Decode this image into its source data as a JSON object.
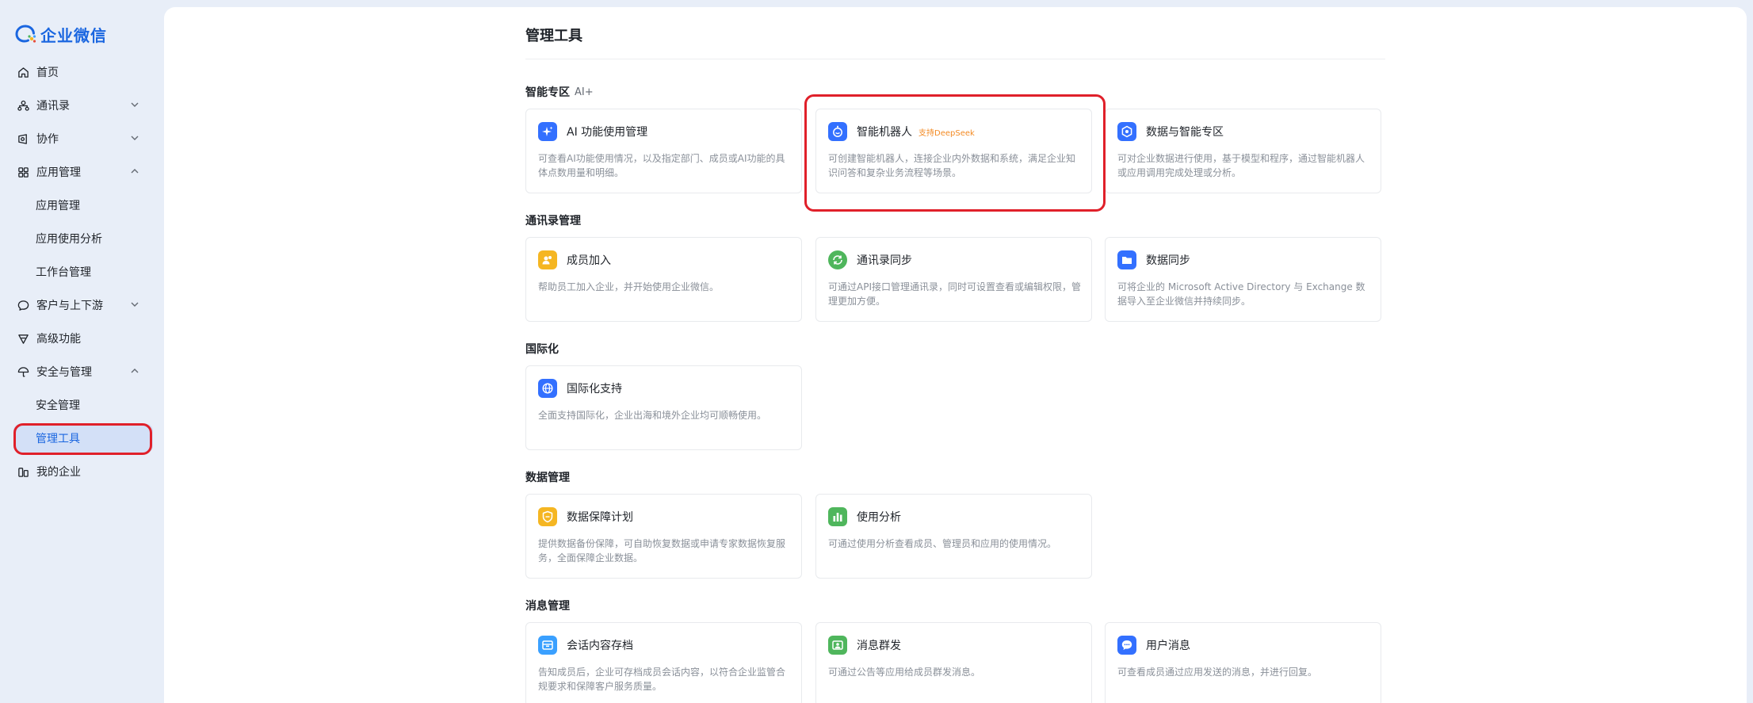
{
  "app": {
    "name": "企业微信"
  },
  "sidebar": {
    "items": [
      {
        "label": "首页"
      },
      {
        "label": "通讯录"
      },
      {
        "label": "协作"
      },
      {
        "label": "应用管理"
      },
      {
        "label": "应用管理"
      },
      {
        "label": "应用使用分析"
      },
      {
        "label": "工作台管理"
      },
      {
        "label": "客户与上下游"
      },
      {
        "label": "高级功能"
      },
      {
        "label": "安全与管理"
      },
      {
        "label": "安全管理"
      },
      {
        "label": "管理工具"
      },
      {
        "label": "我的企业"
      }
    ]
  },
  "main": {
    "title": "管理工具",
    "sections": [
      {
        "title": "智能专区",
        "tag": "AI+",
        "cards": [
          {
            "title": "AI 功能使用管理",
            "desc": "可查看AI功能使用情况，以及指定部门、成员或AI功能的具体点数用量和明细。"
          },
          {
            "title": "智能机器人",
            "badge": "支持DeepSeek",
            "desc": "可创建智能机器人，连接企业内外数据和系统，满足企业知识问答和复杂业务流程等场景。"
          },
          {
            "title": "数据与智能专区",
            "desc": "可对企业数据进行使用，基于模型和程序，通过智能机器人或应用调用完成处理或分析。"
          }
        ]
      },
      {
        "title": "通讯录管理",
        "cards": [
          {
            "title": "成员加入",
            "desc": "帮助员工加入企业，并开始使用企业微信。"
          },
          {
            "title": "通讯录同步",
            "desc": "可通过API接口管理通讯录，同时可设置查看或编辑权限，管理更加方便。"
          },
          {
            "title": "数据同步",
            "desc": "可将企业的 Microsoft Active Directory 与 Exchange 数据导入至企业微信并持续同步。"
          }
        ]
      },
      {
        "title": "国际化",
        "cards": [
          {
            "title": "国际化支持",
            "desc": "全面支持国际化，企业出海和境外企业均可顺畅使用。"
          }
        ]
      },
      {
        "title": "数据管理",
        "cards": [
          {
            "title": "数据保障计划",
            "desc": "提供数据备份保障，可自助恢复数据或申请专家数据恢复服务，全面保障企业数据。"
          },
          {
            "title": "使用分析",
            "desc": "可通过使用分析查看成员、管理员和应用的使用情况。"
          }
        ]
      },
      {
        "title": "消息管理",
        "cards": [
          {
            "title": "会话内容存档",
            "desc": "告知成员后，企业可存档成员会话内容，以符合企业监管合规要求和保障客户服务质量。"
          },
          {
            "title": "消息群发",
            "desc": "可通过公告等应用给成员群发消息。"
          },
          {
            "title": "用户消息",
            "desc": "可查看成员通过应用发送的消息，并进行回复。"
          }
        ]
      }
    ]
  },
  "colors": {
    "accent": "#1a66e0",
    "highlight": "#e0202a",
    "badge": "#f38b25",
    "icon_blue": "#3370ff",
    "icon_yellow": "#f5b622",
    "icon_green": "#4fb65c"
  }
}
